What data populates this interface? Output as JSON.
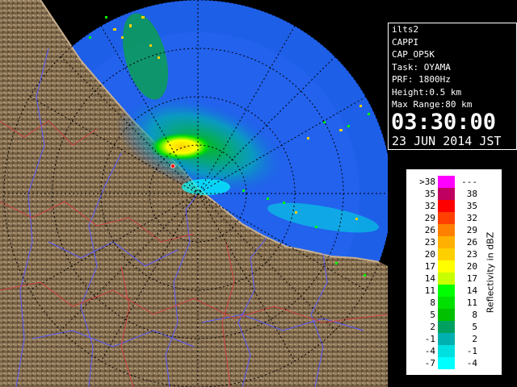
{
  "info": {
    "lines": [
      "ilts2",
      "CAPPI",
      "CAP_OP5K",
      "Task: OYAMA",
      "PRF: 1800Hz",
      "Height:0.5 km",
      "Max Range:80 km"
    ],
    "time": "03:30:00",
    "date": "23 JUN 2014 JST"
  },
  "legend": {
    "unit": "Reflectivity in dBZ",
    "rows": [
      {
        "lo": ">38",
        "hi": "---",
        "color": "#ff00ff"
      },
      {
        "lo": "35",
        "hi": "38",
        "color": "#c00060"
      },
      {
        "lo": "32",
        "hi": "35",
        "color": "#ff0000"
      },
      {
        "lo": "29",
        "hi": "32",
        "color": "#ff4000"
      },
      {
        "lo": "26",
        "hi": "29",
        "color": "#ff8000"
      },
      {
        "lo": "23",
        "hi": "26",
        "color": "#ffb000"
      },
      {
        "lo": "20",
        "hi": "23",
        "color": "#ffd000"
      },
      {
        "lo": "17",
        "hi": "20",
        "color": "#ffff00"
      },
      {
        "lo": "14",
        "hi": "17",
        "color": "#c8ff00"
      },
      {
        "lo": "11",
        "hi": "14",
        "color": "#00ff00"
      },
      {
        "lo": "8",
        "hi": "11",
        "color": "#00e000"
      },
      {
        "lo": "5",
        "hi": "8",
        "color": "#00c000"
      },
      {
        "lo": "2",
        "hi": "5",
        "color": "#00a060"
      },
      {
        "lo": "-1",
        "hi": "2",
        "color": "#00b0b0"
      },
      {
        "lo": "-4",
        "hi": "-1",
        "color": "#00e0e0"
      },
      {
        "lo": "-7",
        "hi": "-4",
        "color": "#00ffff"
      }
    ]
  },
  "colors": {
    "sea": "#1e5fe8",
    "land": "#7a6040",
    "rivers": "#5a5aff",
    "borders": "#d04040",
    "range_rings": "#000000"
  }
}
